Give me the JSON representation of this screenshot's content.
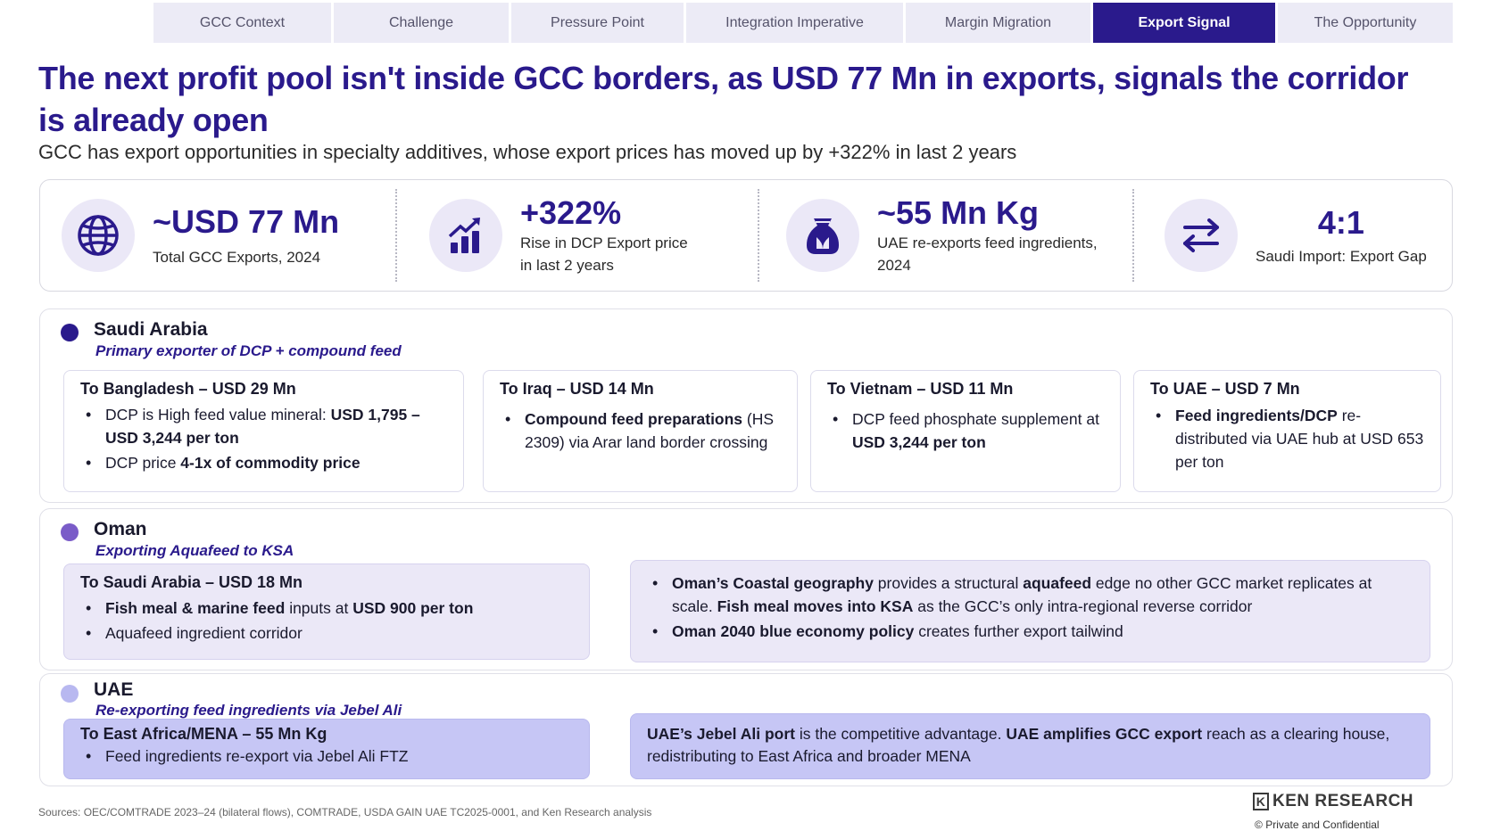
{
  "tabs": [
    {
      "label": "GCC Context"
    },
    {
      "label": "Challenge"
    },
    {
      "label": "Pressure Point"
    },
    {
      "label": "Integration Imperative"
    },
    {
      "label": "Margin Migration"
    },
    {
      "label": "Export Signal"
    },
    {
      "label": "The Opportunity"
    }
  ],
  "active_tab": "Export Signal",
  "title": "The next profit pool isn't inside GCC borders, as USD 77 Mn in exports, signals the corridor is already open",
  "subtitle": "GCC has export opportunities in specialty additives, whose export prices has moved up by +322% in last 2 years",
  "kpis": [
    {
      "icon": "globe-icon",
      "value": "~USD 77 Mn",
      "label": "Total GCC Exports, 2024"
    },
    {
      "icon": "bar-chart-growth-icon",
      "value": "+322%",
      "label_line1": "Rise in DCP Export price",
      "label_line2": "in last 2 years"
    },
    {
      "icon": "feed-sack-icon",
      "value": "~55 Mn Kg",
      "label_line1": "UAE re-exports feed ingredients,",
      "label_line2": "2024"
    },
    {
      "icon": "exchange-arrows-icon",
      "value": "4:1",
      "label": "Saudi Import: Export Gap"
    }
  ],
  "saudi": {
    "country": "Saudi Arabia",
    "role": "Primary exporter of DCP + compound feed",
    "dot_color": "#2a1a8c",
    "cards": [
      {
        "head": "To Bangladesh – USD 29 Mn",
        "b1_pre": "DCP is High feed value mineral: ",
        "b1_bold": "USD 1,795 – USD 3,244 per ton",
        "b2_pre": "DCP price ",
        "b2_bold": "4-1x of commodity price"
      },
      {
        "head": "To Iraq – USD 14 Mn",
        "b1_bold": "Compound feed preparations",
        "b1_post": " (HS 2309) via Arar land border crossing"
      },
      {
        "head": "To Vietnam – USD 11 Mn",
        "b1_pre": "DCP feed phosphate supplement at ",
        "b1_bold": "USD 3,244 per ton"
      },
      {
        "head": "To UAE – USD 7 Mn",
        "b1_bold": "Feed ingredients/DCP",
        "b1_post": " re-distributed via UAE hub at USD 653 per ton"
      }
    ]
  },
  "oman": {
    "country": "Oman",
    "role": "Exporting Aquafeed to KSA",
    "dot_color": "#7a5cc8",
    "card": {
      "head": "To Saudi Arabia – USD 18 Mn",
      "b1_bold": "Fish meal & marine feed",
      "b1_mid": " inputs at ",
      "b1_bold2": "USD 900 per ton",
      "b2": "Aquafeed ingredient corridor"
    },
    "note": {
      "b1_bold": "Oman’s Coastal geography",
      "b1_mid": " provides a structural ",
      "b1_bold2": "aquafeed",
      "b1_mid2": " edge no other GCC market replicates at scale. ",
      "b1_bold3": "Fish meal moves into KSA",
      "b1_post": " as the GCC’s only intra-regional reverse corridor",
      "b2_bold": "Oman 2040 blue economy policy",
      "b2_post": " creates further export tailwind"
    }
  },
  "uae": {
    "country": "UAE",
    "role": "Re-exporting feed ingredients via Jebel Ali",
    "dot_color": "#b8b8f0",
    "card": {
      "head": "To East Africa/MENA – 55 Mn Kg",
      "b1": "Feed ingredients re-export via Jebel Ali FTZ"
    },
    "note": {
      "bold1": "UAE’s Jebel Ali port",
      "mid": " is the competitive advantage. ",
      "bold2": "UAE amplifies GCC export",
      "post": " reach as a clearing house, redistributing to East Africa and broader MENA"
    }
  },
  "footer": {
    "sources": "Sources: OEC/COMTRADE 2023–24 (bilateral flows), COMTRADE, USDA GAIN UAE TC2025-0001, and Ken Research analysis",
    "brand": "KEN RESEARCH",
    "confidential": "Private and Confidential"
  }
}
